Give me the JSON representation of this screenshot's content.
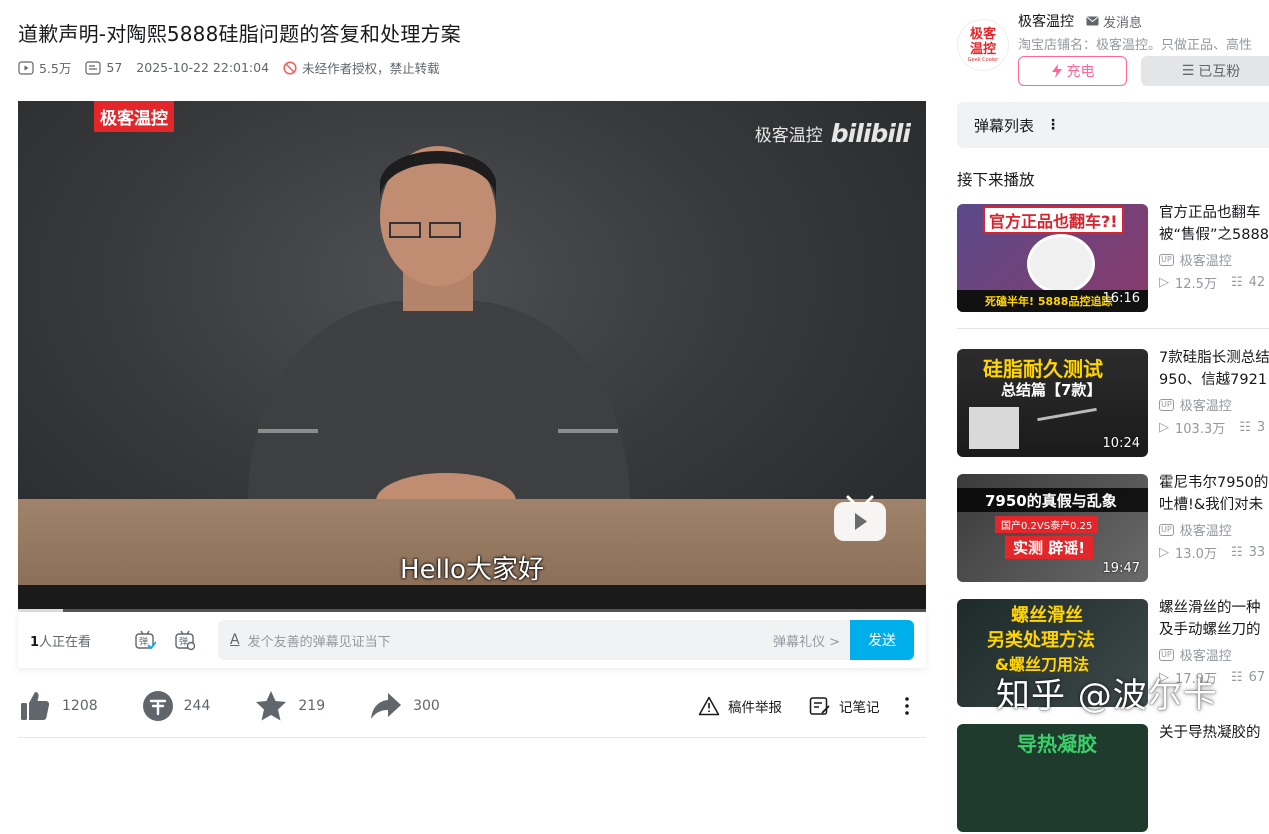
{
  "video": {
    "title": "道歉声明-对陶熙5888硅脂问题的答复和处理方案",
    "views": "5.5万",
    "danmaku_count": "57",
    "datetime": "2025-10-22 22:01:04",
    "copyright": "未经作者授权，禁止转载"
  },
  "player": {
    "brand_tag": "极客温控",
    "watermark_text": "极客温控",
    "watermark_logo": "bilibili",
    "subtitle": "Hello大家好",
    "progress_fraction": 0.05
  },
  "danmaku_bar": {
    "watching_count": "1",
    "watching_suffix": "人正在看",
    "input_placeholder": "发个友善的弹幕见证当下",
    "etiquette": "弹幕礼仪 >",
    "send": "发送"
  },
  "actions": {
    "like": "1208",
    "coin": "244",
    "favorite": "219",
    "share": "300",
    "report": "稿件举报",
    "notes": "记笔记"
  },
  "uploader": {
    "avatar_text": "极客温控",
    "avatar_sub": "Geek Cooler",
    "name": "极客温控",
    "message": "发消息",
    "description": "淘宝店铺名：极客温控。只做正品、高性",
    "charge": "充电",
    "followed": "已互粉"
  },
  "sidebar": {
    "danmaku_list": "弹幕列表",
    "up_next": "接下来播放",
    "cards": [
      {
        "title": "官方正品也翻车",
        "title2": "被“售假”之5888",
        "thumb_text": "官方正品也翻车?!",
        "thumb_sub": "死磕半年! 5888品控追踪",
        "duration": "16:16",
        "uploader": "极客温控",
        "views": "12.5万",
        "danmaku": "42"
      },
      {
        "title": "7款硅脂长测总结",
        "title2": "950、信越7921",
        "thumb_text": "硅脂耐久测试",
        "thumb_sub": "总结篇【7款】",
        "duration": "10:24",
        "uploader": "极客温控",
        "views": "103.3万",
        "danmaku": "3"
      },
      {
        "title": "霍尼韦尔7950的",
        "title2": "吐槽!&我们对未",
        "thumb_text": "7950的真假与乱象",
        "thumb_sub": "实测 辟谣!",
        "thumb_note": "国产0.2VS泰产0.25",
        "duration": "19:47",
        "uploader": "极客温控",
        "views": "13.0万",
        "danmaku": "33"
      },
      {
        "title": "螺丝滑丝的一种",
        "title2": "及手动螺丝刀的",
        "thumb_text": "螺丝滑丝",
        "thumb_sub": "另类处理方法",
        "thumb_note": "&螺丝刀用法",
        "duration": "",
        "uploader": "极客温控",
        "views": "17.9万",
        "danmaku": "67"
      },
      {
        "title": "关于导热凝胶的",
        "title2": "",
        "thumb_text": "导热凝胶",
        "duration": "",
        "uploader": "",
        "views": "",
        "danmaku": ""
      }
    ]
  },
  "overlay_watermark": "知乎 @波尔卡",
  "colors": {
    "accent": "#00aeec",
    "charge_pink": "#ff6699",
    "brand_red": "#e4262a"
  }
}
